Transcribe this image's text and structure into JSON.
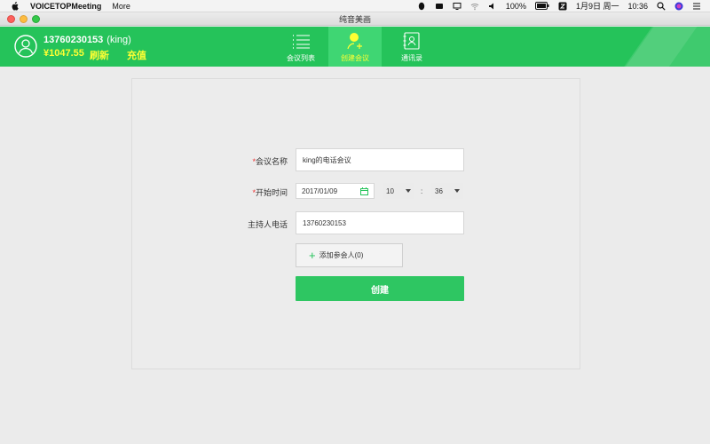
{
  "menubar": {
    "app_name": "VOICETOPMeeting",
    "more": "More",
    "battery": "100%",
    "date": "1月9日 周一",
    "time": "10:36"
  },
  "window": {
    "title": "纯音美画"
  },
  "user": {
    "phone": "13760230153",
    "name": "(king)",
    "balance": "¥1047.55",
    "refresh_label": "刷新",
    "recharge_label": "充值"
  },
  "nav": {
    "list_label": "会议列表",
    "create_label": "创建会议",
    "contacts_label": "通讯录"
  },
  "form": {
    "name_label": "会议名称",
    "name_value": "king的电话会议",
    "start_label": "开始时间",
    "date_value": "2017/01/09",
    "hour_value": "10",
    "minute_value": "36",
    "colon": ":",
    "host_label": "主持人电话",
    "host_value": "13760230153",
    "add_participant_label": "添加参会人(0)",
    "required_mark": "*",
    "create_label": "创建"
  },
  "colors": {
    "header_green": "#25c35a",
    "highlight_yellow": "#ffff33",
    "button_green": "#2ec662"
  }
}
